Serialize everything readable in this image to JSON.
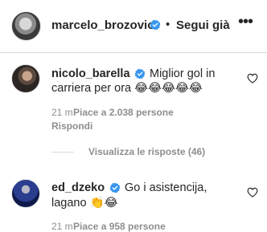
{
  "header": {
    "username": "marcelo_brozovic",
    "separator": "•",
    "follow_label": "Segui già",
    "more_label": "•••"
  },
  "comments": [
    {
      "username": "nicolo_barella",
      "text_line1": "Miglior gol in",
      "text_line2": "carriera per ora",
      "emoji": "😂😂😂😂😂",
      "time": "21 m",
      "likes": "Piace a 2.038 persone",
      "reply_label": "Rispondi"
    },
    {
      "username": "ed_dzeko",
      "text_line1": "Go i asistencija,",
      "text_line2": "lagano",
      "emoji": "👏😂",
      "time": "21 m",
      "likes": "Piace a 958 persone"
    }
  ],
  "view_replies": "Visualizza le risposte (46)",
  "icons": {
    "verified": "verified-badge-icon",
    "like": "heart-icon",
    "more": "more-options-icon"
  },
  "colors": {
    "verified": "#3897f0",
    "text": "#262626",
    "secondary": "#8e8e8e",
    "divider": "#dbdbdb"
  }
}
